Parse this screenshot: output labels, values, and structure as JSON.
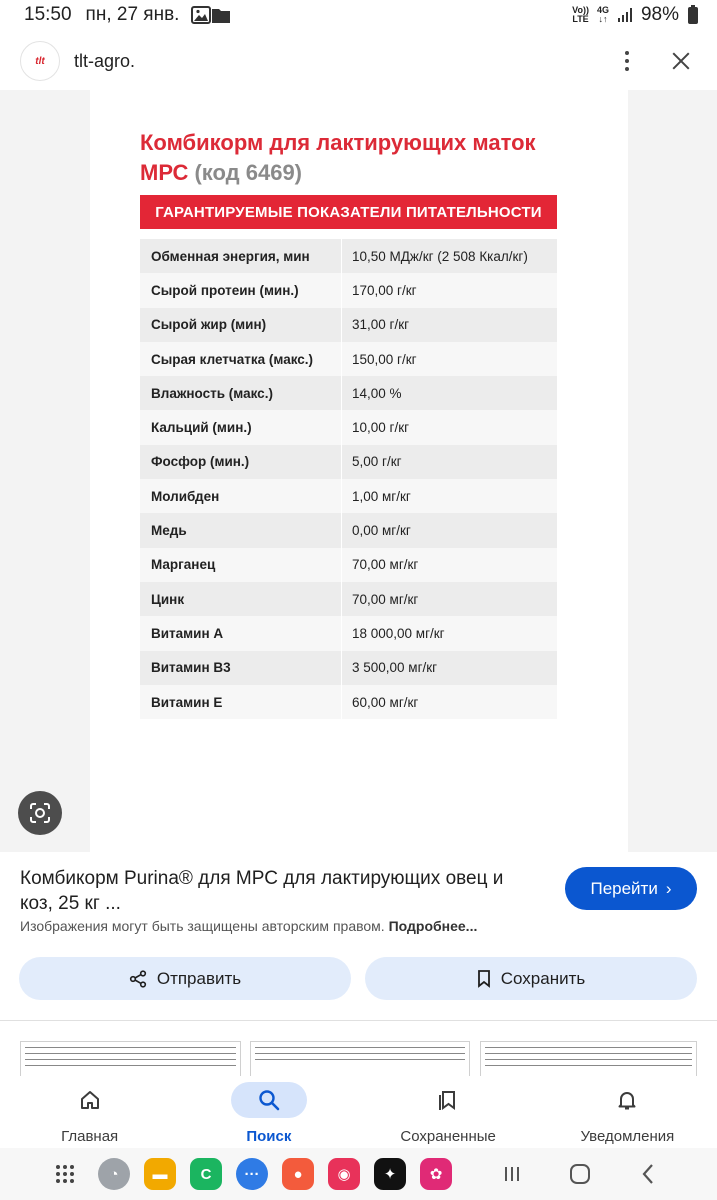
{
  "status_bar": {
    "time": "15:50",
    "date": "пн, 27 янв.",
    "network_top": "Vo))",
    "network_bottom": "LTE",
    "network_type": "4G",
    "battery": "98%"
  },
  "topbar": {
    "logo_text": "tlt",
    "site_name": "tlt-agro."
  },
  "document": {
    "title": "Комбикорм для лактирующих маток МРС",
    "code": "(код 6469)",
    "banner": "ГАРАНТИРУЕМЫЕ ПОКАЗАТЕЛИ ПИТАТЕЛЬНОСТИ",
    "rows": [
      {
        "name": "Обменная энергия, мин",
        "value": "10,50 МДж/кг (2 508 Ккал/кг)"
      },
      {
        "name": "Сырой протеин (мин.)",
        "value": "170,00 г/кг"
      },
      {
        "name": "Сырой жир (мин)",
        "value": "31,00 г/кг"
      },
      {
        "name": "Сырая клетчатка (макс.)",
        "value": "150,00 г/кг"
      },
      {
        "name": "Влажность (макс.)",
        "value": "14,00 %"
      },
      {
        "name": "Кальций (мин.)",
        "value": "10,00 г/кг"
      },
      {
        "name": "Фосфор (мин.)",
        "value": "5,00 г/кг"
      },
      {
        "name": "Молибден",
        "value": "1,00 мг/кг"
      },
      {
        "name": "Медь",
        "value": "0,00 мг/кг"
      },
      {
        "name": "Марганец",
        "value": "70,00 мг/кг"
      },
      {
        "name": "Цинк",
        "value": "70,00 мг/кг"
      },
      {
        "name": "Витамин А",
        "value": "18 000,00 мг/кг"
      },
      {
        "name": "Витамин В3",
        "value": "3 500,00 мг/кг"
      },
      {
        "name": "Витамин Е",
        "value": "60,00 мг/кг"
      }
    ]
  },
  "info": {
    "title": "Комбикорм Purina® для МРС для лактирующих овец и коз, 25 кг ...",
    "go_label": "Перейти",
    "copyright": "Изображения могут быть защищены авторским правом.",
    "more_link": "Подробнее..."
  },
  "actions": {
    "share_label": "Отправить",
    "save_label": "Сохранить"
  },
  "bottom_nav": {
    "items": [
      {
        "label": "Главная",
        "icon": "home-icon"
      },
      {
        "label": "Поиск",
        "icon": "search-icon"
      },
      {
        "label": "Сохраненные",
        "icon": "bookmarks-icon"
      },
      {
        "label": "Уведомления",
        "icon": "bell-icon"
      }
    ],
    "active": "Поиск"
  },
  "dock": {
    "apps": [
      "app-grid-icon",
      "messages-bubble-icon",
      "files-icon",
      "phone-icon",
      "chat-icon",
      "contacts-icon",
      "camera-icon",
      "ai-sparkle-icon",
      "flower-gallery-icon"
    ]
  },
  "colors": {
    "accent": "#0b57d0",
    "brand_red": "#e32636",
    "chip_bg": "#e2ecfb"
  }
}
